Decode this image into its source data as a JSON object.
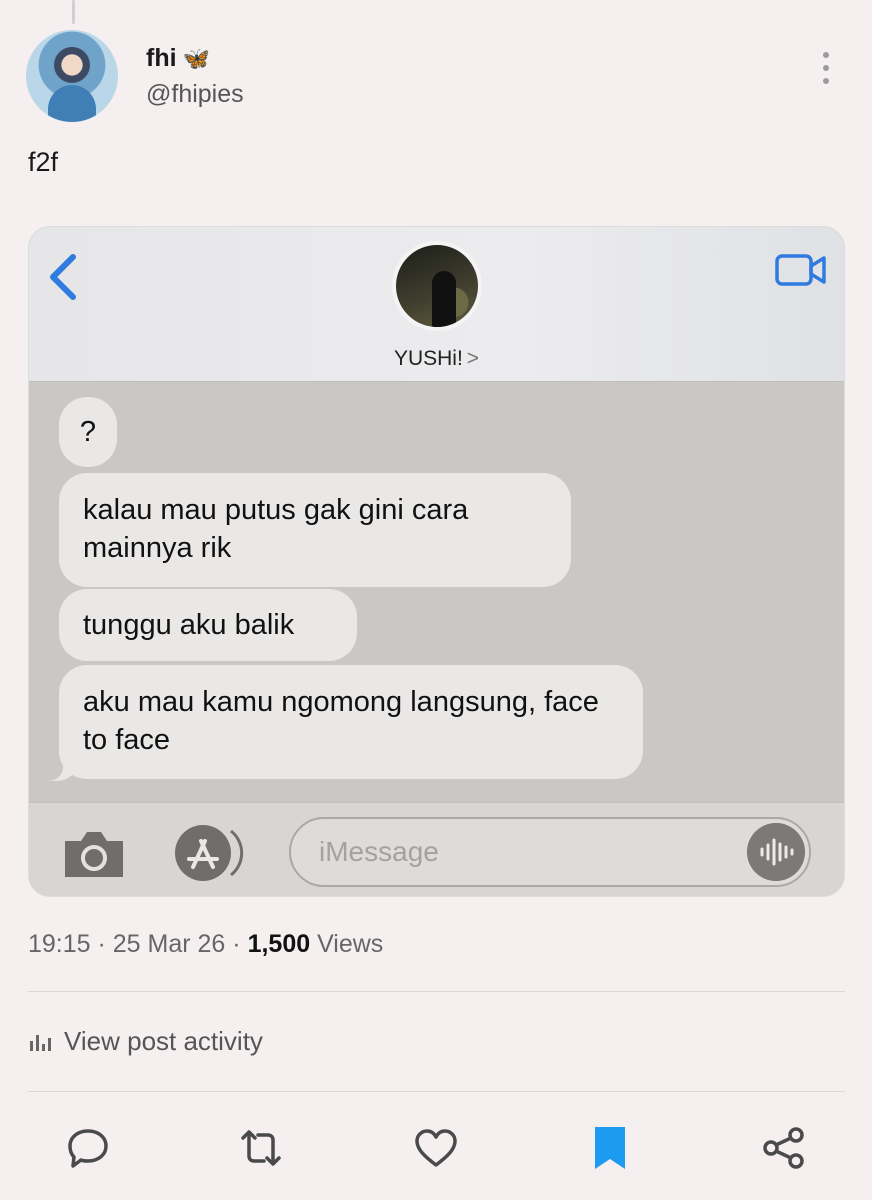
{
  "post": {
    "author": {
      "display_name": "fhi",
      "name_emoji": "🦋",
      "handle": "@fhipies"
    },
    "text": "f2f",
    "timestamp": "19:15 · 25 Mar 26 · ",
    "views_count": "1,500",
    "views_label": " Views",
    "activity_label": "View post activity"
  },
  "screenshot": {
    "contact_name": "YUSHi!",
    "contact_chevron": ">",
    "messages": [
      "?",
      "kalau mau putus gak gini cara mainnya rik",
      "tunggu aku balik",
      "aku mau kamu ngomong langsung, face to face"
    ],
    "input_placeholder": "iMessage"
  },
  "icons": {
    "more": "more-vertical-icon",
    "back": "chevron-left-icon",
    "video": "video-camera-icon",
    "camera": "camera-icon",
    "appstore": "app-store-icon",
    "audio": "audio-waveform-icon",
    "activity": "bar-chart-icon",
    "reply": "reply-icon",
    "repost": "repost-icon",
    "like": "heart-icon",
    "bookmark": "bookmark-icon",
    "share": "share-icon"
  },
  "colors": {
    "ios_blue": "#2f7be0",
    "bookmark_blue": "#1d9bf0",
    "background": "#f5eff0"
  }
}
